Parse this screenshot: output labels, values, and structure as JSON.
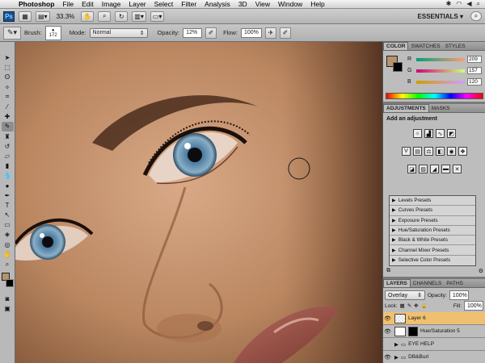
{
  "menubar": {
    "apple": "",
    "items": [
      "Photoshop",
      "File",
      "Edit",
      "Image",
      "Layer",
      "Select",
      "Filter",
      "Analysis",
      "3D",
      "View",
      "Window",
      "Help"
    ]
  },
  "appbar": {
    "logo": "Ps",
    "zoom": "33.3%",
    "workspace": "ESSENTIALS ▾"
  },
  "options": {
    "brush_label": "Brush:",
    "brush_size": "172",
    "mode_label": "Mode:",
    "mode_value": "Normal",
    "opacity_label": "Opacity:",
    "opacity_value": "12%",
    "flow_label": "Flow:",
    "flow_value": "100%"
  },
  "color_panel": {
    "tabs": [
      "COLOR",
      "SWATCHES",
      "STYLES"
    ],
    "r_label": "R",
    "r_value": "209",
    "g_label": "G",
    "g_value": "157",
    "b_label": "B",
    "b_value": "120",
    "fg_color": "#b8926c"
  },
  "adjustments": {
    "tabs": [
      "ADJUSTMENTS",
      "MASKS"
    ],
    "title": "Add an adjustment",
    "presets": [
      "Levels Presets",
      "Curves Presets",
      "Exposure Presets",
      "Hue/Saturation Presets",
      "Black & White Presets",
      "Channel Mixer Presets",
      "Selective Color Presets"
    ]
  },
  "layers": {
    "tabs": [
      "LAYERS",
      "CHANNELS",
      "PATHS"
    ],
    "blend_mode": "Overlay",
    "opacity_label": "Opacity:",
    "opacity_value": "100%",
    "lock_label": "Lock:",
    "fill_label": "Fill:",
    "fill_value": "100%",
    "items": [
      {
        "name": "Layer 6",
        "selected": true
      },
      {
        "name": "Hue/Saturation 5",
        "selected": false
      },
      {
        "name": "EYE HELP",
        "selected": false
      },
      {
        "name": "DB&Burl",
        "selected": false
      }
    ]
  }
}
